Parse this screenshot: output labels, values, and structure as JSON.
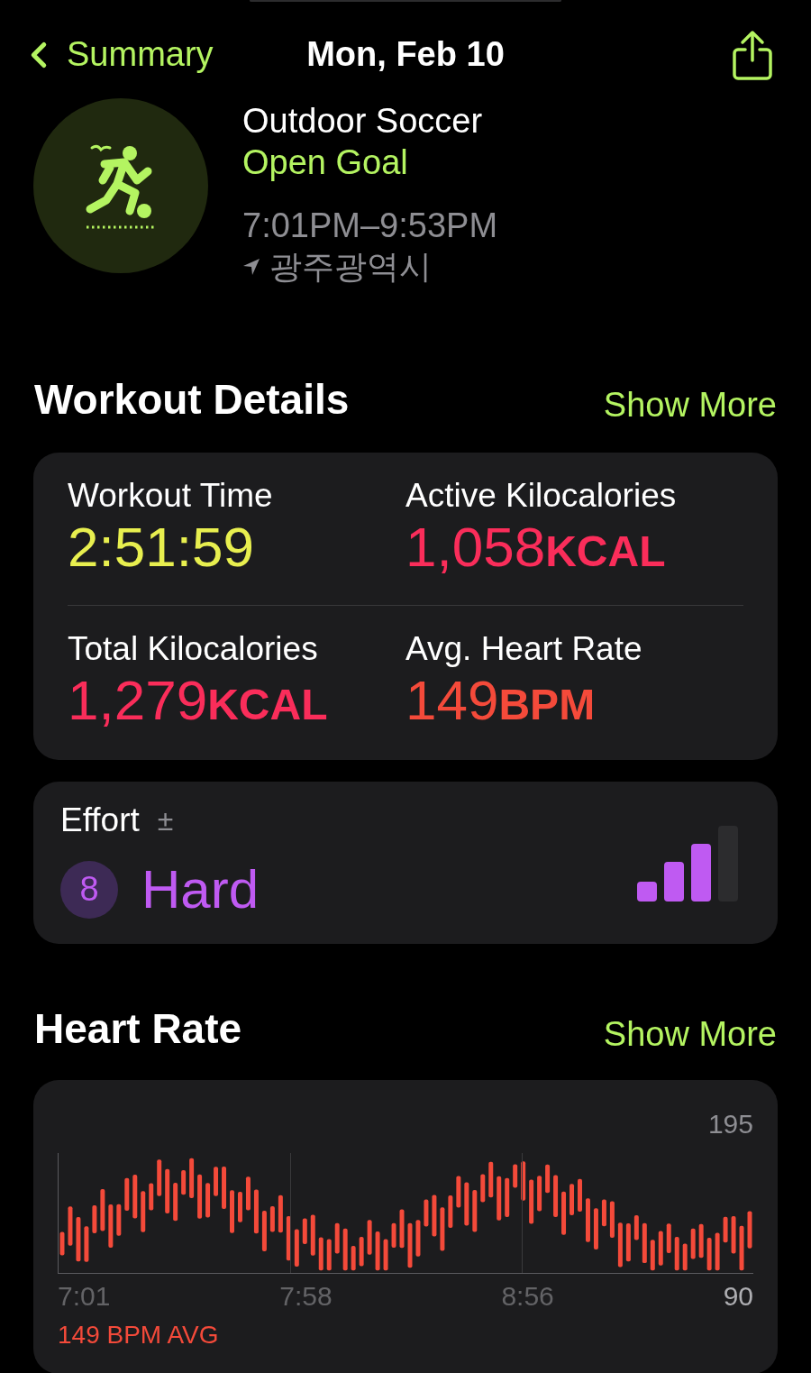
{
  "nav": {
    "back_label": "Summary",
    "title": "Mon, Feb 10"
  },
  "workout": {
    "name": "Outdoor Soccer",
    "goal": "Open Goal",
    "time_range": "7:01PM–9:53PM",
    "location": "광주광역시"
  },
  "workout_details": {
    "title": "Workout Details",
    "show_more": "Show More",
    "metrics": [
      {
        "label": "Workout Time",
        "value": "2:51:59",
        "color": "#e8ef4f"
      },
      {
        "label": "Active Kilocalories",
        "value": "1,058",
        "unit": "KCAL",
        "color": "#fa2d5a"
      },
      {
        "label": "Total Kilocalories",
        "value": "1,279",
        "unit": "KCAL",
        "color": "#fa2d5a"
      },
      {
        "label": "Avg. Heart Rate",
        "value": "149",
        "unit": "BPM",
        "color": "#f44a3a"
      }
    ]
  },
  "effort": {
    "label": "Effort",
    "adjust_icon": "±",
    "score": "8",
    "rating": "Hard",
    "level": 0.75
  },
  "heart_rate": {
    "title": "Heart Rate",
    "show_more": "Show More",
    "max_label": "195",
    "min_label": "90",
    "time_labels": [
      "7:01",
      "7:58",
      "8:56"
    ],
    "average": "149 BPM AVG"
  }
}
